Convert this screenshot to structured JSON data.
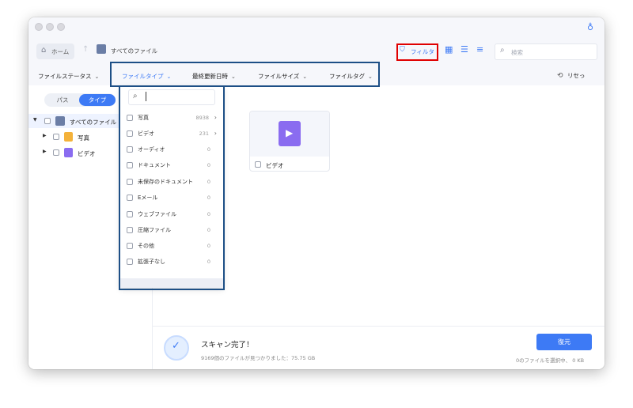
{
  "toolbar": {
    "home_label": "ホーム",
    "path_label": "すべてのファイル",
    "filter_label": "フィルタ",
    "search_placeholder": "検索"
  },
  "filterbar": {
    "file_status": "ファイルステータス",
    "file_type": "ファイルタイプ",
    "last_modified": "最終更新日時",
    "file_size": "ファイルサイズ",
    "file_tag": "ファイルタグ",
    "reset": "リセっ"
  },
  "sidebar": {
    "seg_path": "パス",
    "seg_type": "タイプ",
    "tree": [
      {
        "label": "すべてのファイル"
      },
      {
        "label": "写真"
      },
      {
        "label": "ビデオ"
      }
    ]
  },
  "dropdown": {
    "items": [
      {
        "label": "写真",
        "count": "8938",
        "has_arrow": true
      },
      {
        "label": "ビデオ",
        "count": "231",
        "has_arrow": true
      },
      {
        "label": "オーディオ",
        "count": "0"
      },
      {
        "label": "ドキュメント",
        "count": "0"
      },
      {
        "label": "未保存のドキュメント",
        "count": "0"
      },
      {
        "label": "Eメール",
        "count": "0"
      },
      {
        "label": "ウェブファイル",
        "count": "0"
      },
      {
        "label": "圧縮ファイル",
        "count": "0"
      },
      {
        "label": "その他",
        "count": "0"
      },
      {
        "label": "拡張子なし",
        "count": "0"
      }
    ]
  },
  "content": {
    "card_video_label": "ビデオ"
  },
  "footer": {
    "title": "スキャン完了！",
    "summary": "9169個のファイルが見つかりました：75.75 GB",
    "recover_button": "復元",
    "selected_text": "0のファイルを選択中、 0 KB"
  },
  "colors": {
    "accent": "#3d7af5",
    "highlight_red": "#e00000",
    "highlight_blue": "#1d4f86",
    "video_purple": "#8a6cf0",
    "photo_orange": "#f4b23a"
  }
}
